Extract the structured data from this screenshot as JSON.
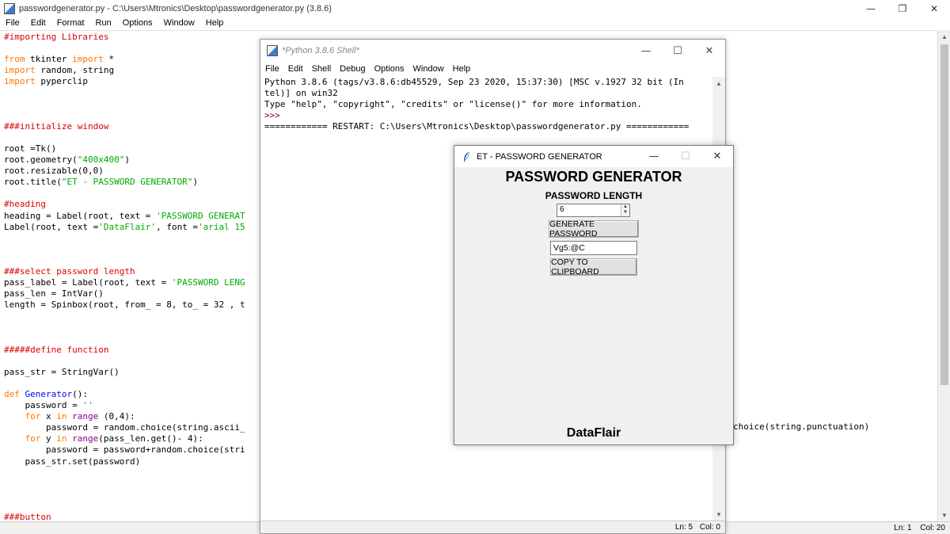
{
  "editor": {
    "title": "passwordgenerator.py - C:\\Users\\Mtronics\\Desktop\\passwordgenerator.py (3.8.6)",
    "menu": [
      "File",
      "Edit",
      "Format",
      "Run",
      "Options",
      "Window",
      "Help"
    ],
    "controls": {
      "minimize": "—",
      "restore": "❐",
      "close": "✕"
    },
    "status": {
      "line": "Ln: 1",
      "col": "Col: 20"
    },
    "code": [
      [
        [
          "c-comment",
          "#importing Libraries"
        ]
      ],
      [],
      [
        [
          "c-kw",
          "from"
        ],
        [
          "",
          " tkinter "
        ],
        [
          "c-kw",
          "import"
        ],
        [
          "",
          " *"
        ]
      ],
      [
        [
          "c-kw",
          "import"
        ],
        [
          "",
          " random, string"
        ]
      ],
      [
        [
          "c-kw",
          "import"
        ],
        [
          "",
          " pyperclip"
        ]
      ],
      [],
      [],
      [],
      [
        [
          "c-comment",
          "###initialize window"
        ]
      ],
      [],
      [
        [
          "",
          "root =Tk()"
        ]
      ],
      [
        [
          "",
          "root.geometry("
        ],
        [
          "c-str",
          "\"400x400\""
        ],
        [
          "",
          ")"
        ]
      ],
      [
        [
          "",
          "root.resizable(0,0)"
        ]
      ],
      [
        [
          "",
          "root.title("
        ],
        [
          "c-str",
          "\"ET - PASSWORD GENERATOR\""
        ],
        [
          "",
          ")"
        ]
      ],
      [],
      [
        [
          "c-comment",
          "#heading"
        ]
      ],
      [
        [
          "",
          "heading = Label(root, text = "
        ],
        [
          "c-str",
          "'PASSWORD GENERAT"
        ]
      ],
      [
        [
          "",
          "Label(root, text ="
        ],
        [
          "c-str",
          "'DataFlair'"
        ],
        [
          "",
          ", font ="
        ],
        [
          "c-str",
          "'arial 15"
        ]
      ],
      [],
      [],
      [],
      [
        [
          "c-comment",
          "###select password length"
        ]
      ],
      [
        [
          "",
          "pass_label = Label(root, text = "
        ],
        [
          "c-str",
          "'PASSWORD LENG"
        ]
      ],
      [
        [
          "",
          "pass_len = IntVar()"
        ]
      ],
      [
        [
          "",
          "length = Spinbox(root, from_ = 8, to_ = 32 , t"
        ]
      ],
      [],
      [],
      [],
      [
        [
          "c-comment",
          "#####define function"
        ]
      ],
      [],
      [
        [
          "",
          "pass_str = StringVar()"
        ]
      ],
      [],
      [
        [
          "c-kw",
          "def"
        ],
        [
          "",
          " "
        ],
        [
          "c-def",
          "Generator"
        ],
        [
          "",
          "():"
        ]
      ],
      [
        [
          "",
          "    password = "
        ],
        [
          "c-str",
          "''"
        ]
      ],
      [
        [
          "",
          "    "
        ],
        [
          "c-kw",
          "for"
        ],
        [
          "",
          " x "
        ],
        [
          "c-kw",
          "in"
        ],
        [
          "",
          " "
        ],
        [
          "c-bi",
          "range"
        ],
        [
          "",
          " (0,4):"
        ]
      ],
      [
        [
          "",
          "        password = random.choice(string.ascii_"
        ]
      ],
      [
        [
          "",
          "    "
        ],
        [
          "c-kw",
          "for"
        ],
        [
          "",
          " y "
        ],
        [
          "c-kw",
          "in"
        ],
        [
          "",
          " "
        ],
        [
          "c-bi",
          "range"
        ],
        [
          "",
          "(pass_len.get()- 4):"
        ]
      ],
      [
        [
          "",
          "        password = password+random.choice(stri"
        ]
      ],
      [
        [
          "",
          "    pass_str.set(password)"
        ]
      ],
      [],
      [],
      [],
      [],
      [
        [
          "c-comment",
          "###button"
        ]
      ]
    ],
    "overflow_text": "choice(string.punctuation)"
  },
  "shell": {
    "title": "*Python 3.8.6 Shell*",
    "menu": [
      "File",
      "Edit",
      "Shell",
      "Debug",
      "Options",
      "Window",
      "Help"
    ],
    "controls": {
      "minimize": "—",
      "maximize": "☐",
      "close": "✕"
    },
    "lines": [
      "Python 3.8.6 (tags/v3.8.6:db45529, Sep 23 2020, 15:37:30) [MSC v.1927 32 bit (In",
      "tel)] on win32",
      "Type \"help\", \"copyright\", \"credits\" or \"license()\" for more information."
    ],
    "prompt": ">>>",
    "restart_line": "============ RESTART: C:\\Users\\Mtronics\\Desktop\\passwordgenerator.py ============",
    "status": {
      "line": "Ln: 5",
      "col": "Col: 0"
    }
  },
  "app": {
    "title": "ET - PASSWORD GENERATOR",
    "controls": {
      "minimize": "—",
      "maximize": "☐",
      "close": "✕"
    },
    "heading": "PASSWORD GENERATOR",
    "length_label": "PASSWORD LENGTH",
    "length_value": "6",
    "generate_label": "GENERATE PASSWORD",
    "password_value": "Vg5:@C",
    "copy_label": "COPY TO CLIPBOARD",
    "brand": "DataFlair"
  }
}
